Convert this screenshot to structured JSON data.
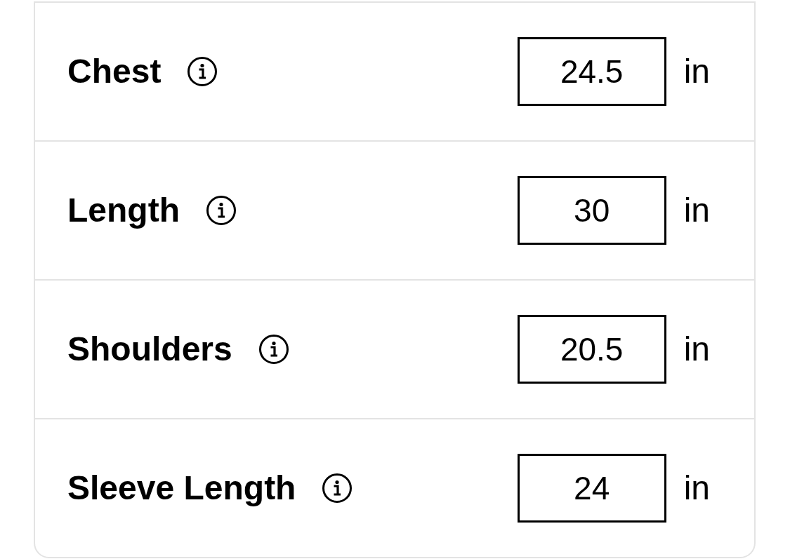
{
  "measurements": [
    {
      "label": "Chest",
      "value": "24.5",
      "unit": "in"
    },
    {
      "label": "Length",
      "value": "30",
      "unit": "in"
    },
    {
      "label": "Shoulders",
      "value": "20.5",
      "unit": "in"
    },
    {
      "label": "Sleeve Length",
      "value": "24",
      "unit": "in"
    }
  ]
}
